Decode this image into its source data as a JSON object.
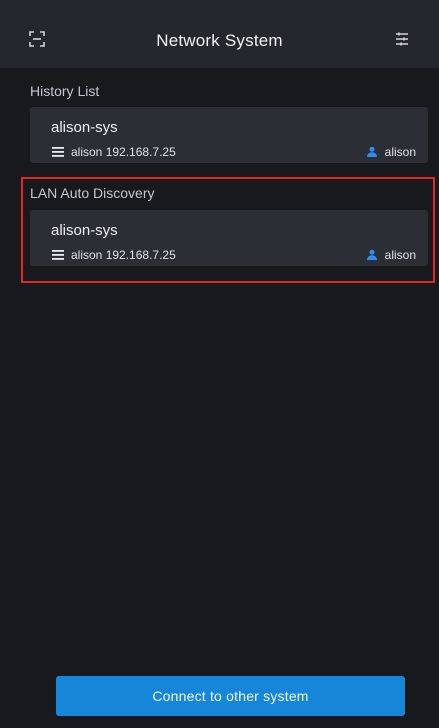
{
  "header": {
    "title": "Network System"
  },
  "sections": [
    {
      "label": "History List",
      "item": {
        "name": "alison-sys",
        "meta": "alison 192.168.7.25",
        "user": "alison"
      }
    },
    {
      "label": "LAN Auto Discovery",
      "item": {
        "name": "alison-sys",
        "meta": "alison 192.168.7.25",
        "user": "alison"
      }
    }
  ],
  "footer": {
    "button_label": "Connect to other system"
  },
  "colors": {
    "background": "#17191d",
    "header": "#24272d",
    "card": "#2b2e34",
    "accent": "#1686d9",
    "highlight": "#e12626"
  },
  "icons": {
    "left_header": "scan-icon",
    "right_header": "settings-sliders-icon",
    "card_meta": "menu-icon",
    "user": "user-icon"
  }
}
